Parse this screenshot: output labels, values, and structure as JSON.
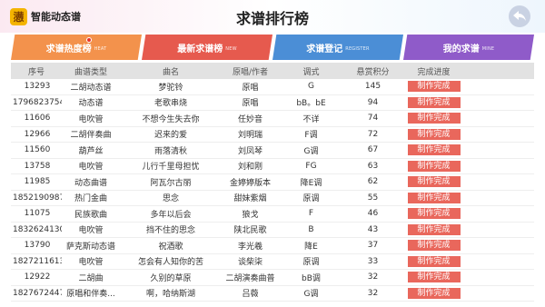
{
  "header": {
    "app_name": "智能动态谱",
    "logo_char": "懑",
    "title": "求谱排行榜",
    "back_icon": "back-arrow-icon"
  },
  "tabs": [
    {
      "label": "求谱热度榜",
      "sub": "HEAT",
      "color": "#f3924c"
    },
    {
      "label": "最新求谱榜",
      "sub": "NEW",
      "color": "#e65a4e"
    },
    {
      "label": "求谱登记",
      "sub": "REGISTER",
      "color": "#4b8ed6"
    },
    {
      "label": "我的求谱",
      "sub": "MINE",
      "color": "#8f5bc9"
    }
  ],
  "table": {
    "columns": [
      "序号",
      "曲谱类型",
      "曲名",
      "原唱/作者",
      "调式",
      "悬赏积分",
      "完成进度"
    ],
    "rows": [
      [
        "13293",
        "二胡动态谱",
        "梦驼铃",
        "原唱",
        "G",
        "145",
        "制作完成"
      ],
      [
        "1796823754...",
        "动态谱",
        "老歌串烧",
        "原唱",
        "bB。bE",
        "94",
        "制作完成"
      ],
      [
        "11606",
        "电吹管",
        "不想今生失去你",
        "任妙音",
        "不详",
        "74",
        "制作完成"
      ],
      [
        "12966",
        "二胡伴奏曲",
        "迟来的爱",
        "刘明瑞",
        "F调",
        "72",
        "制作完成"
      ],
      [
        "11560",
        "葫芦丝",
        "雨落清秋",
        "刘凤琴",
        "G调",
        "67",
        "制作完成"
      ],
      [
        "13758",
        "电吹管",
        "儿行千里母担忧",
        "刘和刚",
        "FG",
        "63",
        "制作完成"
      ],
      [
        "11985",
        "动态曲谱",
        "阿瓦尔古丽",
        "金婷婷版本",
        "降E调",
        "62",
        "制作完成"
      ],
      [
        "1852190987...",
        "热门金曲",
        "思念",
        "甜妹紫烟",
        "原调",
        "55",
        "制作完成"
      ],
      [
        "11075",
        "民族歌曲",
        "多年以后会",
        "狼戈",
        "F",
        "46",
        "制作完成"
      ],
      [
        "1832624130...",
        "电吹管",
        "挡不住的思念",
        "陕北民歌",
        "B",
        "43",
        "制作完成"
      ],
      [
        "13790",
        "萨克斯动态谱",
        "祝酒歌",
        "李光羲",
        "降E",
        "37",
        "制作完成"
      ],
      [
        "1827211613...",
        "电吹管",
        "怎会有人知你的苦",
        "谈柴柒",
        "原调",
        "33",
        "制作完成"
      ],
      [
        "12922",
        "二胡曲",
        "久别的草原",
        "二胡演奏曲普",
        "bB调",
        "32",
        "制作完成"
      ],
      [
        "1827672447...",
        "原唱和伴奏...",
        "啊，哈纳斯湖",
        "吕薇",
        "G调",
        "32",
        "制作完成"
      ]
    ]
  },
  "colors": {
    "status": "#e9675c",
    "header_row": "#e2e2e2"
  }
}
